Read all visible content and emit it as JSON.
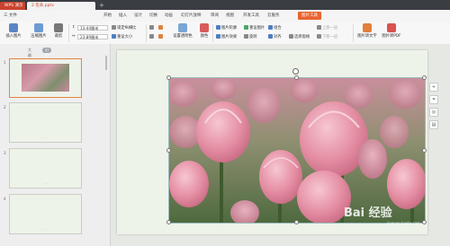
{
  "titlebar": {
    "app_tab": "WPS 演示",
    "doc_tab": "2 花朵.pptx",
    "new_tab": "+"
  },
  "menu": {
    "file": "三 文件",
    "items": [
      "开始",
      "插入",
      "设计",
      "切换",
      "动画",
      "幻灯片放映",
      "审阅",
      "视图",
      "开发工具",
      "云服务"
    ],
    "picture_tools": "图片工具"
  },
  "ribbon": {
    "insert_picture": "插入图片",
    "compress": "压缩图片",
    "crop": "裁剪",
    "height_value": "13.44厘米",
    "width_value": "23.89厘米",
    "lock_ratio": "锁定纵横比",
    "reset_size": "重设大小",
    "set_transparent": "设置透明色",
    "color": "颜色",
    "picture_outline": "图片轮廓",
    "picture_effect": "图片效果",
    "rotate": "旋转",
    "reset_picture": "重设图片",
    "group": "组合",
    "align": "对齐",
    "up_layer": "上移一层",
    "down_layer": "下移一层",
    "selection_pane": "选择窗格",
    "picture_to_pdf": "图片转PDF",
    "picture_to_text": "图片转文字"
  },
  "leftpane": {
    "tab_outline": "大纲",
    "tab_slides": "幻灯片",
    "slides": [
      {
        "num": "1",
        "has_image": true,
        "selected": true
      },
      {
        "num": "2",
        "has_image": false,
        "selected": false
      },
      {
        "num": "3",
        "has_image": false,
        "selected": false
      },
      {
        "num": "4",
        "has_image": false,
        "selected": false
      }
    ]
  },
  "sidetools": [
    "+",
    "⌗",
    "◎",
    "▤"
  ],
  "watermark": {
    "main": "Bai 经验",
    "sub": "jingyan.baidu.com"
  },
  "colors": {
    "accent": "#e9642f",
    "titlebar": "#3a3d42",
    "selected_border": "#e9823f"
  }
}
